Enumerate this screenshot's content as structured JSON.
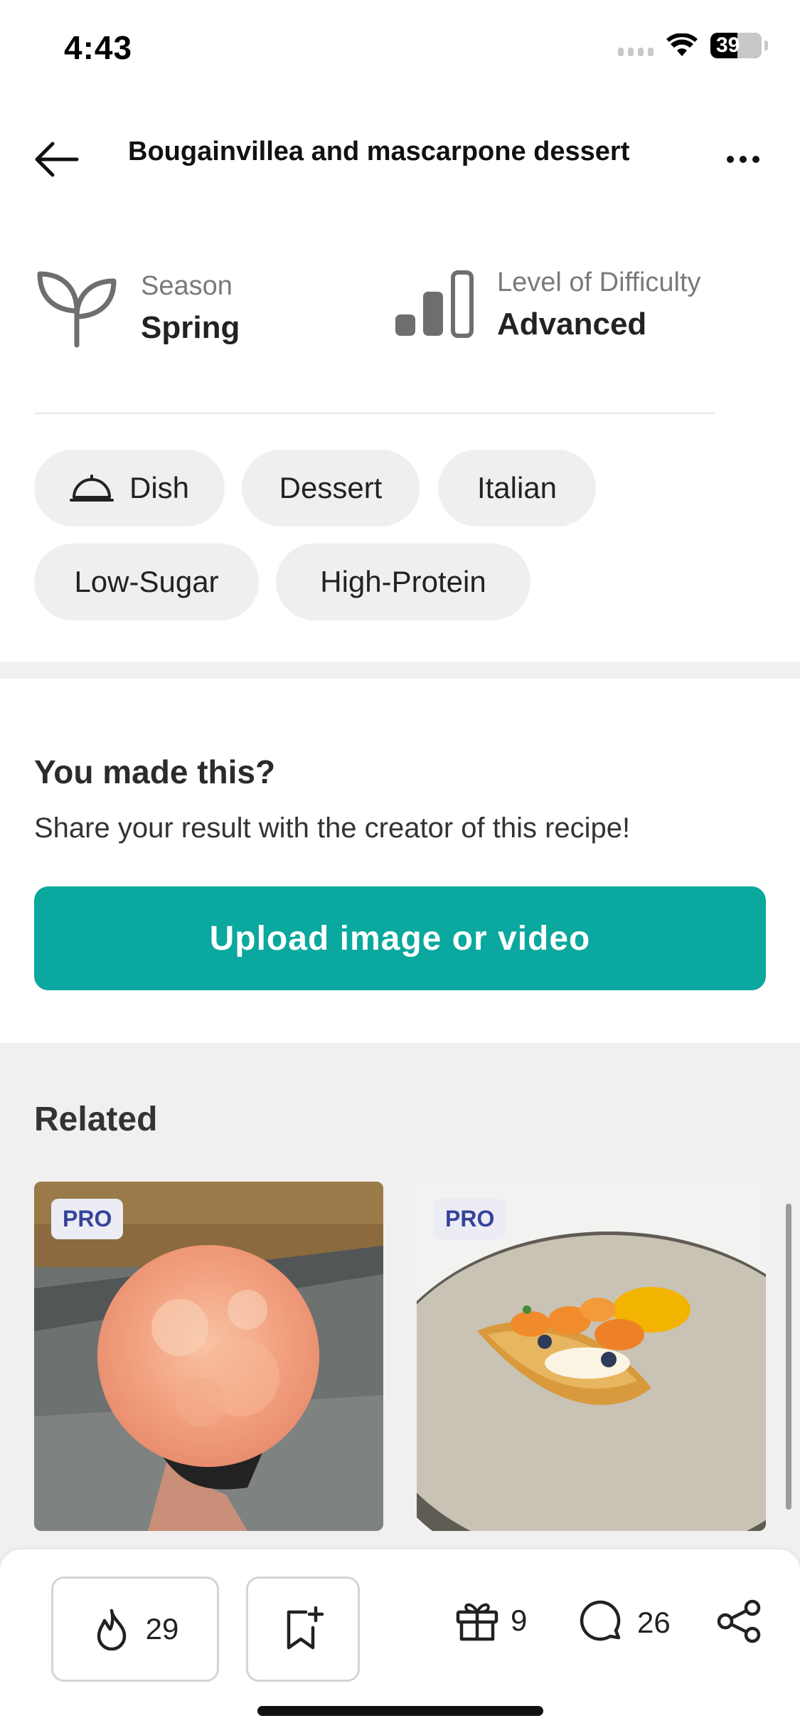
{
  "status_bar": {
    "time": "4:43",
    "battery": "39"
  },
  "header": {
    "title": "Bougainvillea and mascarpone dessert"
  },
  "meta": {
    "season_label": "Season",
    "season_value": "Spring",
    "difficulty_label": "Level of Difficulty",
    "difficulty_value": "Advanced"
  },
  "tags": [
    "Dish",
    "Dessert",
    "Italian",
    "Low-Sugar",
    "High-Protein"
  ],
  "made_this": {
    "title": "You made this?",
    "subtitle": "Share your result with the creator of this recipe!",
    "upload_label": "Upload image or video"
  },
  "related": {
    "title": "Related",
    "cards": [
      {
        "badge": "PRO"
      },
      {
        "badge": "PRO"
      }
    ]
  },
  "bottom_bar": {
    "likes": "29",
    "gifts": "9",
    "comments": "26"
  },
  "colors": {
    "accent": "#0aa89e",
    "pro_badge_text": "#35449a",
    "pro_badge_bg": "#ececf5"
  },
  "icons": {
    "back": "arrow-left-icon",
    "more": "more-icon",
    "season": "sprout-icon",
    "difficulty": "difficulty-bars-icon",
    "dish": "cloche-icon",
    "like": "flame-icon",
    "save": "bookmark-plus-icon",
    "gift": "gift-icon",
    "comment": "comment-icon",
    "share": "share-icon"
  }
}
